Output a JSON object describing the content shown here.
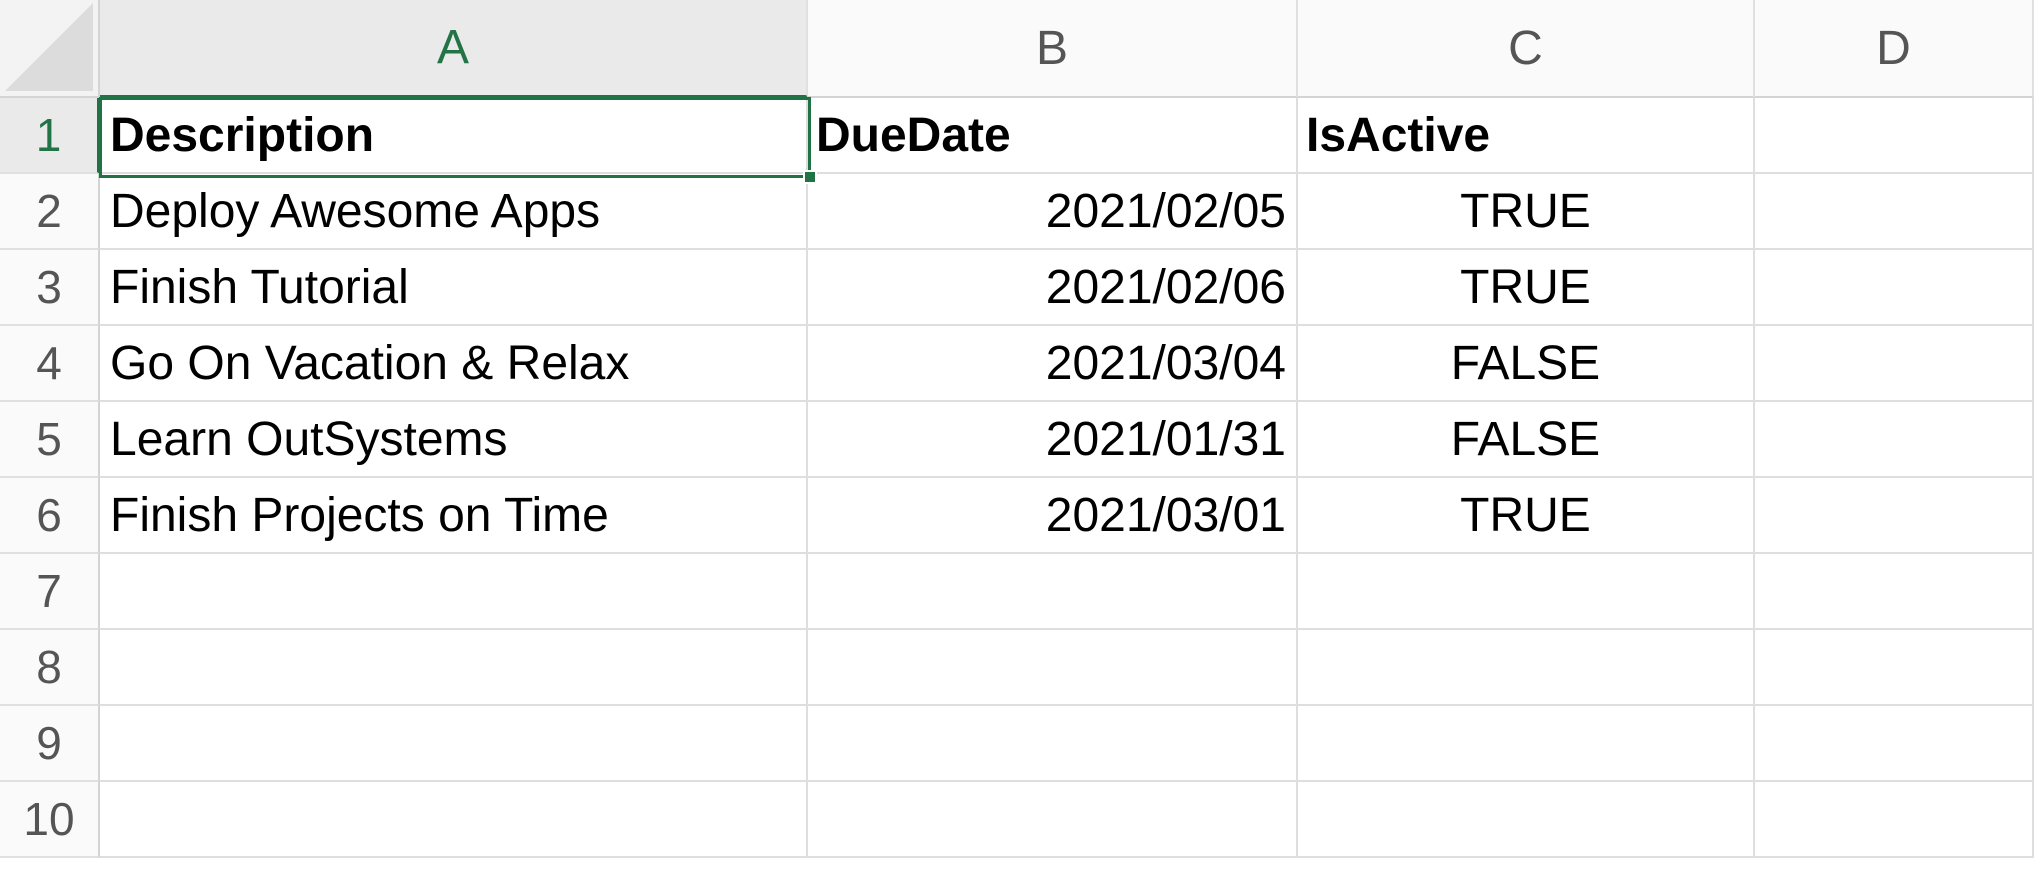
{
  "columns": [
    "A",
    "B",
    "C",
    "D"
  ],
  "rows": [
    "1",
    "2",
    "3",
    "4",
    "5",
    "6",
    "7",
    "8",
    "9",
    "10"
  ],
  "selected_cell": "A1",
  "headers": {
    "description": "Description",
    "due_date": "DueDate",
    "is_active": "IsActive"
  },
  "data": [
    {
      "description": "Deploy Awesome Apps",
      "due_date": "2021/02/05",
      "is_active": "TRUE"
    },
    {
      "description": "Finish Tutorial",
      "due_date": "2021/02/06",
      "is_active": "TRUE"
    },
    {
      "description": "Go On Vacation & Relax",
      "due_date": "2021/03/04",
      "is_active": "FALSE"
    },
    {
      "description": "Learn OutSystems",
      "due_date": "2021/01/31",
      "is_active": "FALSE"
    },
    {
      "description": "Finish Projects on Time",
      "due_date": "2021/03/01",
      "is_active": "TRUE"
    }
  ],
  "colors": {
    "selection_accent": "#217346",
    "header_background": "#fafafa",
    "gridline": "#dedede"
  }
}
